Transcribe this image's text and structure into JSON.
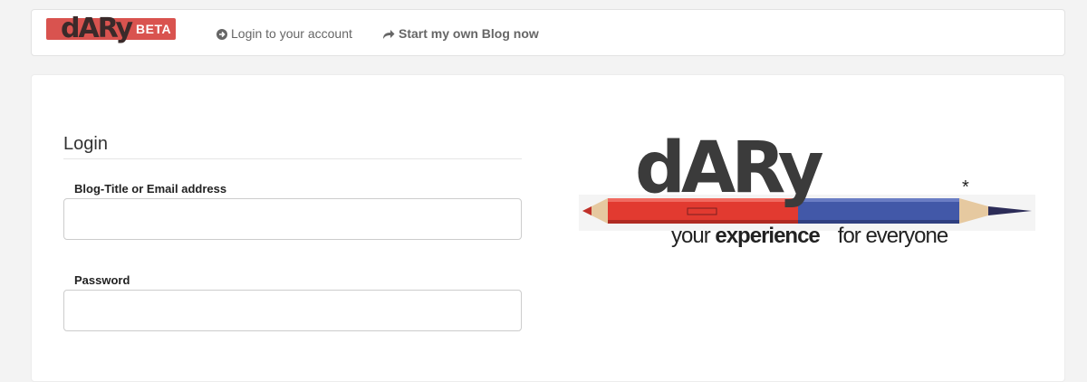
{
  "navbar": {
    "brand_name": "dARy",
    "brand_badge": "BETA",
    "login_link": "Login to your account",
    "start_blog_link": "Start my own Blog now",
    "login_icon": "circle-arrow-right-icon",
    "start_icon": "share-arrow-icon"
  },
  "login_form": {
    "legend": "Login",
    "username_label": "Blog-Title or Email address",
    "username_value": "",
    "password_label": "Password",
    "password_value": ""
  },
  "hero": {
    "name": "dARy",
    "star": "*",
    "tagline_1": "your",
    "tagline_2": "experience",
    "tagline_3": "for everyone"
  },
  "colors": {
    "brand_red": "#d9534f",
    "pencil_red": "#e23a30",
    "pencil_blue": "#4258a8"
  }
}
